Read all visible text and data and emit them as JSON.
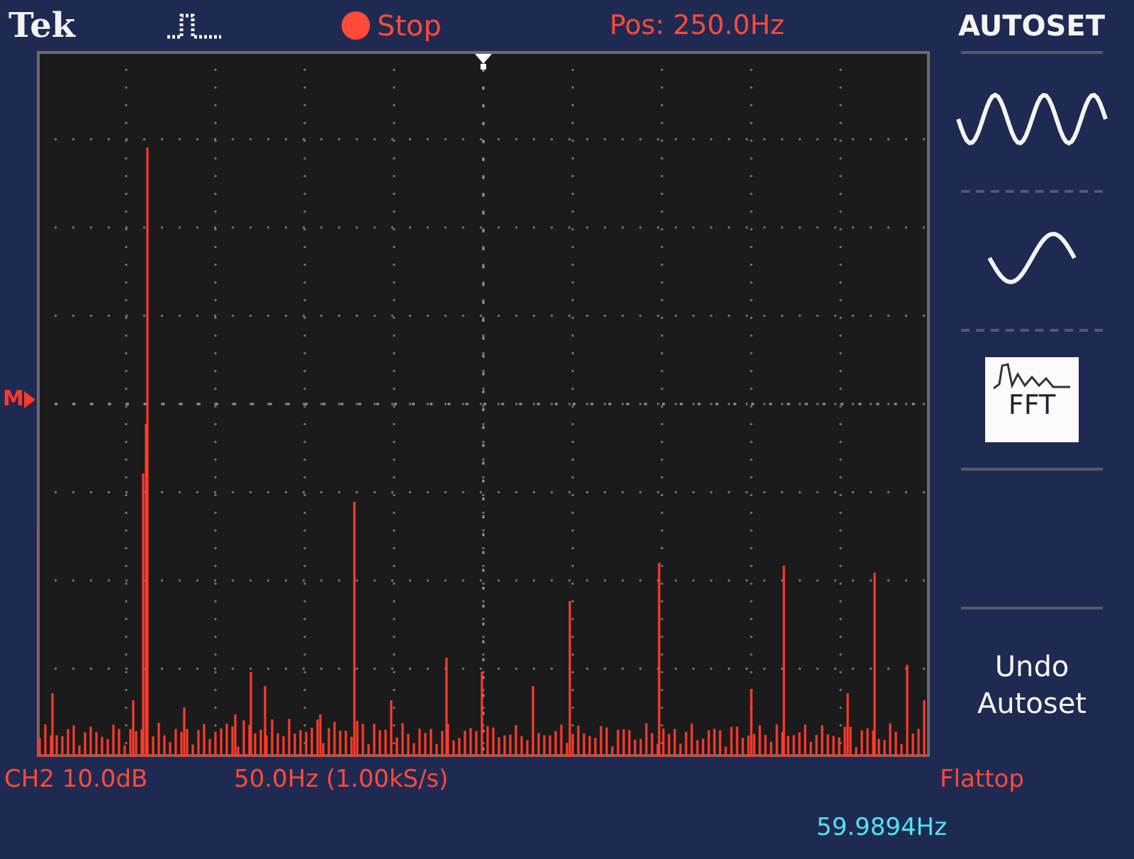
{
  "header": {
    "brand": "Tek",
    "run_state": {
      "label": "Stop",
      "running": false
    },
    "position": "Pos: 250.0Hz"
  },
  "graticule": {
    "reference_marker": "M"
  },
  "menu": {
    "title": "AUTOSET",
    "items": [
      {
        "kind": "multi-cycle",
        "selected": false
      },
      {
        "kind": "single-cycle",
        "selected": false
      },
      {
        "kind": "fft",
        "label": "FFT",
        "selected": true
      },
      {
        "kind": "empty"
      },
      {
        "kind": "text",
        "label": "Undo Autoset"
      }
    ]
  },
  "status_bar": {
    "channel_scale": "CH2 10.0dB",
    "timebase": "50.0Hz (1.00kS/s)",
    "window": "Flattop",
    "frequency": "59.9894Hz"
  }
}
